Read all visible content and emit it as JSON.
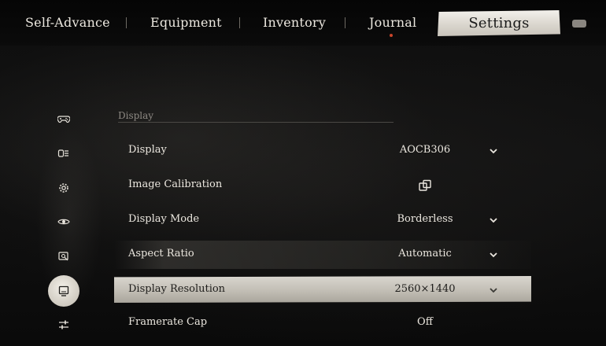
{
  "nav": {
    "tabs": [
      {
        "label": "Self-Advance"
      },
      {
        "label": "Equipment"
      },
      {
        "label": "Inventory"
      },
      {
        "label": "Journal"
      },
      {
        "label": "Settings"
      }
    ],
    "active_tab": "Settings"
  },
  "sidebar": {
    "icons": [
      {
        "name": "gamepad-icon"
      },
      {
        "name": "controls-icon"
      },
      {
        "name": "gear-icon"
      },
      {
        "name": "eye-icon"
      },
      {
        "name": "search-screen-icon"
      },
      {
        "name": "display-icon",
        "active": true
      },
      {
        "name": "sliders-icon"
      }
    ]
  },
  "section": {
    "title": "Display"
  },
  "settings": [
    {
      "label": "Display",
      "value": "AOCB306",
      "control": "dropdown"
    },
    {
      "label": "Image Calibration",
      "value": "",
      "control": "external"
    },
    {
      "label": "Display Mode",
      "value": "Borderless",
      "control": "dropdown"
    },
    {
      "label": "Aspect Ratio",
      "value": "Automatic",
      "control": "dropdown"
    },
    {
      "label": "Display Resolution",
      "value": "2560×1440",
      "control": "dropdown",
      "selected": true
    },
    {
      "label": "Framerate Cap",
      "value": "Off",
      "control": "value"
    }
  ],
  "colors": {
    "accent_dot": "#c9452b",
    "selected_bg": "#cfcbc3",
    "background": "#0c0c0c"
  }
}
